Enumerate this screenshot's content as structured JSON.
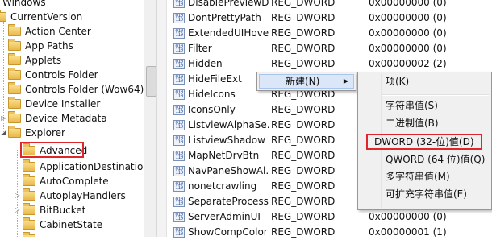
{
  "tree": {
    "items": [
      {
        "label": "Windows"
      },
      {
        "label": "CurrentVersion"
      },
      {
        "label": "Action Center"
      },
      {
        "label": "App Paths"
      },
      {
        "label": "Applets"
      },
      {
        "label": "Controls Folder"
      },
      {
        "label": "Controls Folder (Wow64)"
      },
      {
        "label": "Device Installer"
      },
      {
        "label": "Device Metadata"
      },
      {
        "label": "Explorer"
      },
      {
        "label": "Advanced"
      },
      {
        "label": "ApplicationDestinations"
      },
      {
        "label": "AutoComplete"
      },
      {
        "label": "AutoplayHandlers"
      },
      {
        "label": "BitBucket"
      },
      {
        "label": "CabinetState"
      }
    ]
  },
  "values": {
    "rows": [
      {
        "name": "DisablePreviewD...",
        "type": "REG_DWORD",
        "data": "0x00000000 (0)"
      },
      {
        "name": "DontPrettyPath",
        "type": "REG_DWORD",
        "data": "0x00000000 (0)"
      },
      {
        "name": "ExtendedUIHove...",
        "type": "REG_DWORD",
        "data": "0x00000000 (0)"
      },
      {
        "name": "Filter",
        "type": "REG_DWORD",
        "data": "0x00000000 (0)"
      },
      {
        "name": "Hidden",
        "type": "REG_DWORD",
        "data": "0x00000002 (2)"
      },
      {
        "name": "HideFileExt",
        "type": "",
        "data": ""
      },
      {
        "name": "HideIcons",
        "type": "REG_DWORD",
        "data": ""
      },
      {
        "name": "IconsOnly",
        "type": "REG_DWORD",
        "data": ""
      },
      {
        "name": "ListviewAlphaSe...",
        "type": "REG_DWORD",
        "data": ""
      },
      {
        "name": "ListviewShadow",
        "type": "REG_DWORD",
        "data": ""
      },
      {
        "name": "MapNetDrvBtn",
        "type": "REG_DWORD",
        "data": ""
      },
      {
        "name": "NavPaneShowAl...",
        "type": "REG_DWORD",
        "data": ""
      },
      {
        "name": "nonetcrawling",
        "type": "REG_DWORD",
        "data": ""
      },
      {
        "name": "SeparateProcess",
        "type": "REG_DWORD",
        "data": ""
      },
      {
        "name": "ServerAdminUI",
        "type": "REG_DWORD",
        "data": "0x00000000 (0)"
      },
      {
        "name": "ShowCompColor",
        "type": "REG_DWORD",
        "data": "0x00000001 (1)"
      }
    ]
  },
  "context_menu": {
    "new_label": "新建(N)",
    "arrow": "▶"
  },
  "submenu": {
    "key": "项(K)",
    "string_value": "字符串值(S)",
    "binary_value": "二进制值(B)",
    "dword_value": "DWORD (32-位)值(D)",
    "qword_value": "QWORD (64 位)值(Q)",
    "multi_string_value": "多字符串值(M)",
    "expandable_string_value": "可扩充字符串值(E)"
  },
  "colors": {
    "highlight_box": "#e0262b",
    "menu_hover": "#dbe7f8"
  },
  "icons": {
    "tree_folder": "folder-icon",
    "reg_value": "reg-dword-icon",
    "submenu_arrow": "chevron-right-icon"
  }
}
